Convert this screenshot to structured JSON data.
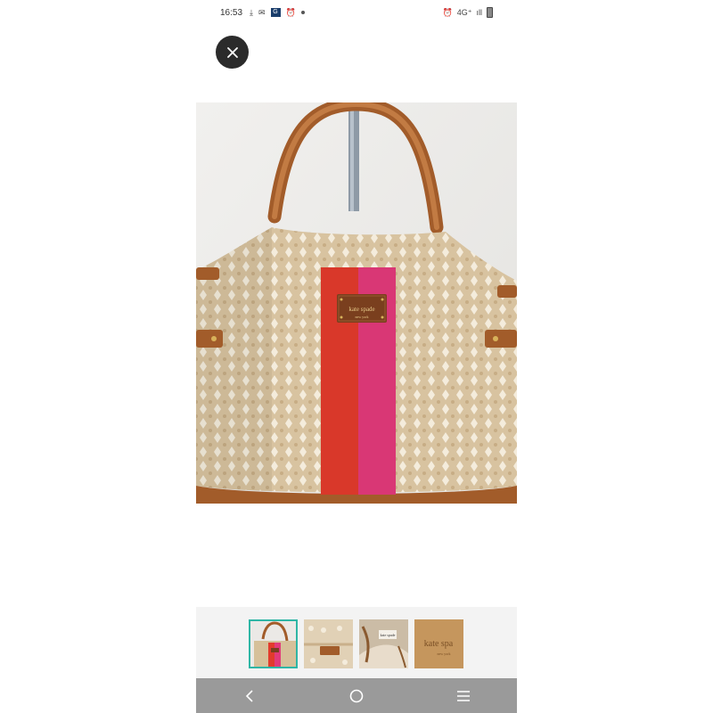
{
  "status_bar": {
    "time": "16:53",
    "left_icons": [
      "download-icon",
      "message-icon",
      "app-icon",
      "alarm-icon"
    ],
    "app_icon_text": "G",
    "network": "4G⁺",
    "signal": "ıll",
    "right_icons": [
      "alarm-icon",
      "network-4g-icon",
      "signal-icon",
      "battery-icon"
    ]
  },
  "close_button": {
    "icon": "close-icon"
  },
  "main_image": {
    "subject": "handbag",
    "logo_text": "kate spade",
    "logo_subtext": "new york",
    "colors": {
      "bag": "#d7c09c",
      "stripe_red": "#e23b2c",
      "stripe_pink": "#e23a7a",
      "leather": "#b06a34",
      "wall": "#ededeb"
    }
  },
  "thumbnails": {
    "count": 4,
    "active_index": 0,
    "items": [
      {
        "name": "thumbnail-1",
        "logo_text": ""
      },
      {
        "name": "thumbnail-2",
        "logo_text": ""
      },
      {
        "name": "thumbnail-3",
        "logo_text": "kate spade"
      },
      {
        "name": "thumbnail-4",
        "logo_text": "kate spa",
        "logo_subtext": "new york"
      }
    ],
    "active_color": "#2fb6a5"
  },
  "nav_bar": {
    "buttons": [
      {
        "name": "back-button",
        "icon": "back-icon"
      },
      {
        "name": "home-button",
        "icon": "home-icon"
      },
      {
        "name": "recents-button",
        "icon": "recents-icon"
      }
    ]
  }
}
